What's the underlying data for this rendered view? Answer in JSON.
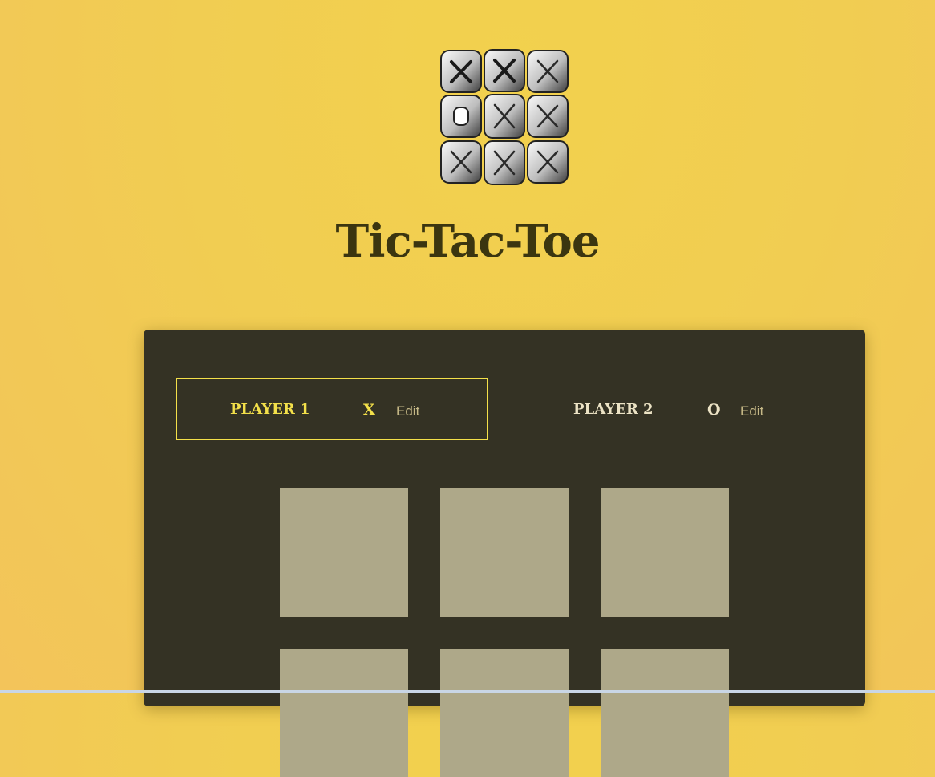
{
  "game": {
    "title": "Tic-Tac-Toe",
    "logo_icon": "tic-tac-toe-board-icon"
  },
  "players": [
    {
      "name": "PLAYER 1",
      "symbol": "X",
      "edit_label": "Edit",
      "active": true
    },
    {
      "name": "PLAYER 2",
      "symbol": "O",
      "edit_label": "Edit",
      "active": false
    }
  ],
  "board": {
    "cells": [
      "",
      "",
      "",
      "",
      "",
      "",
      "",
      "",
      ""
    ]
  },
  "colors": {
    "background": "#f2d04f",
    "title": "#3b3510",
    "panel": "#343224",
    "cell": "#aea889",
    "active_player": "#f3e04a"
  }
}
